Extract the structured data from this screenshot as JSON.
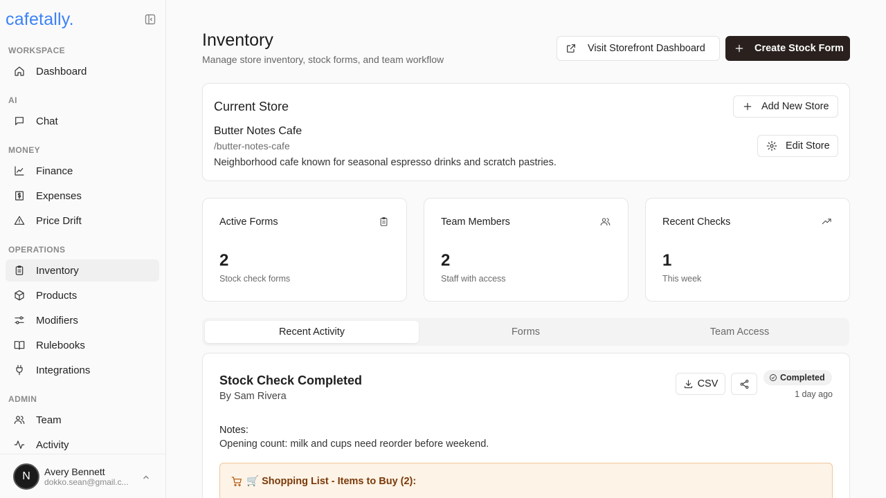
{
  "app": {
    "brand": "cafetally."
  },
  "sidebar": {
    "sections": [
      {
        "label": "WORKSPACE",
        "items": [
          {
            "label": "Dashboard",
            "icon": "home-icon"
          }
        ]
      },
      {
        "label": "AI",
        "items": [
          {
            "label": "Chat",
            "icon": "chat-icon"
          }
        ]
      },
      {
        "label": "MONEY",
        "items": [
          {
            "label": "Finance",
            "icon": "chart-line-icon"
          },
          {
            "label": "Expenses",
            "icon": "dollar-receipt-icon"
          },
          {
            "label": "Price Drift",
            "icon": "warning-triangle-icon"
          }
        ]
      },
      {
        "label": "OPERATIONS",
        "items": [
          {
            "label": "Inventory",
            "icon": "clipboard-icon"
          },
          {
            "label": "Products",
            "icon": "package-icon"
          },
          {
            "label": "Modifiers",
            "icon": "sliders-icon"
          },
          {
            "label": "Rulebooks",
            "icon": "book-icon"
          },
          {
            "label": "Integrations",
            "icon": "plug-icon"
          }
        ]
      },
      {
        "label": "ADMIN",
        "items": [
          {
            "label": "Team",
            "icon": "users-icon"
          },
          {
            "label": "Activity",
            "icon": "activity-icon"
          }
        ]
      }
    ],
    "user": {
      "initial": "N",
      "name": "Avery Bennett",
      "email": "dokko.sean@gmail.c..."
    }
  },
  "header": {
    "title": "Inventory",
    "subtitle": "Manage store inventory, stock forms, and team workflow",
    "visit_button": "Visit Storefront Dashboard",
    "create_button": "Create Stock Form"
  },
  "store": {
    "section_title": "Current Store",
    "name": "Butter Notes Cafe",
    "slug": "/butter-notes-cafe",
    "description": "Neighborhood cafe known for seasonal espresso drinks and scratch pastries.",
    "add_button": "Add New Store",
    "edit_button": "Edit Store"
  },
  "stats": [
    {
      "label": "Active Forms",
      "value": "2",
      "sub": "Stock check forms",
      "icon": "clipboard-icon"
    },
    {
      "label": "Team Members",
      "value": "2",
      "sub": "Staff with access",
      "icon": "users-icon"
    },
    {
      "label": "Recent Checks",
      "value": "1",
      "sub": "This week",
      "icon": "trending-up-icon"
    }
  ],
  "tabs": [
    "Recent Activity",
    "Forms",
    "Team Access"
  ],
  "activity": {
    "title": "Stock Check Completed",
    "by": "By Sam Rivera",
    "csv_button": "CSV",
    "status": "Completed",
    "time": "1 day ago",
    "notes_label": "Notes:",
    "notes_text": "Opening count: milk and cups need reorder before weekend.",
    "shopping_title": "🛒 Shopping List - Items to Buy (2):"
  },
  "colors": {
    "brand": "#3b82f6",
    "primary_button": "#2a211f",
    "warning_bg": "#fdf3e6",
    "warning_border": "#f0c79a"
  }
}
